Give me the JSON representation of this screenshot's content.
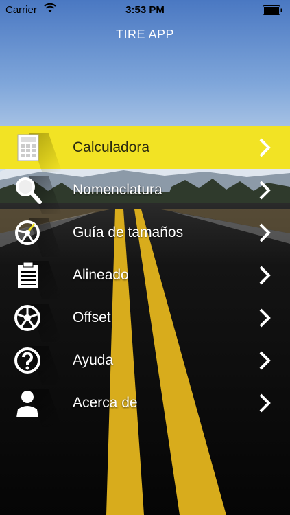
{
  "status_bar": {
    "carrier": "Carrier",
    "time": "3:53 PM"
  },
  "nav": {
    "title": "TIRE APP"
  },
  "menu": [
    {
      "label": "Calculadora",
      "icon": "calculator-icon",
      "active": true
    },
    {
      "label": "Nomenclatura",
      "icon": "magnifier-icon",
      "active": false
    },
    {
      "label": "Guía de tamaños",
      "icon": "compass-icon",
      "active": false
    },
    {
      "label": "Alineado",
      "icon": "clipboard-icon",
      "active": false
    },
    {
      "label": "Offset",
      "icon": "wheel-icon",
      "active": false
    },
    {
      "label": "Ayuda",
      "icon": "help-icon",
      "active": false
    },
    {
      "label": "Acerca de",
      "icon": "person-icon",
      "active": false
    }
  ],
  "colors": {
    "accent": "#f2e324",
    "sky_top": "#3d6fbf",
    "road": "#111111",
    "line": "#e0b21a"
  }
}
